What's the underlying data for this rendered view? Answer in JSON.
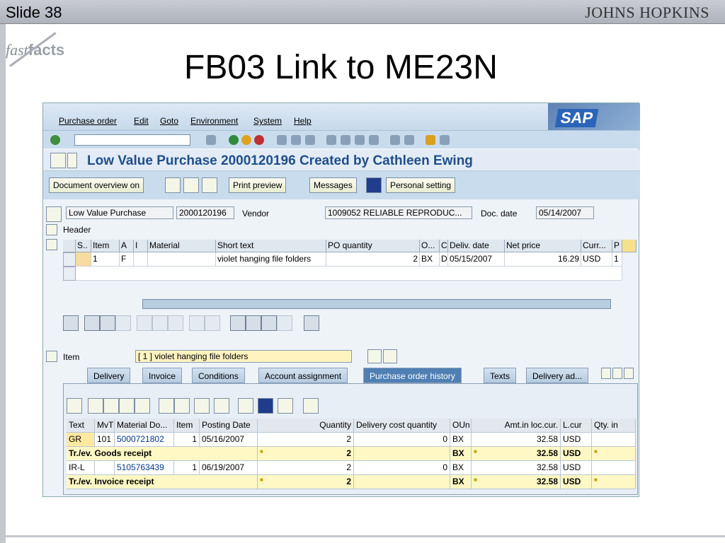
{
  "slide": {
    "number": "Slide 38",
    "brand": "JOHNS HOPKINS",
    "logo_fast": "fast",
    "logo_facts": "facts",
    "title": "FB03 Link to ME23N"
  },
  "sap": {
    "menu": [
      "Purchase order",
      "Edit",
      "Goto",
      "Environment",
      "System",
      "Help"
    ],
    "logo": "SAP",
    "heading": "Low Value Purchase 2000120196 Created by Cathleen Ewing",
    "app_buttons": {
      "doc_overview": "Document overview on",
      "print_preview": "Print preview",
      "messages": "Messages",
      "personal_setting": "Personal setting"
    },
    "header": {
      "doc_type": "Low Value Purchase",
      "po_number": "2000120196",
      "vendor_label": "Vendor",
      "vendor": "1009052 RELIABLE REPRODUC...",
      "doc_date_label": "Doc. date",
      "doc_date": "05/14/2007",
      "header_label": "Header"
    },
    "item_cols": [
      "S..",
      "Item",
      "A",
      "I",
      "Material",
      "Short text",
      "PO quantity",
      "O...",
      "C",
      "Deliv. date",
      "Net price",
      "Curr...",
      "P"
    ],
    "item_row": {
      "item": "1",
      "a": "F",
      "short_text": "violet hanging file folders",
      "qty": "2",
      "unit": "BX",
      "c": "D",
      "deliv_date": "05/15/2007",
      "net_price": "16.29",
      "curr": "USD",
      "p": "1"
    },
    "item_detail": {
      "label": "Item",
      "value": "[ 1 ] violet hanging file folders"
    },
    "tabs": [
      "Delivery",
      "Invoice",
      "Conditions",
      "Account assignment",
      "Purchase order history",
      "Texts",
      "Delivery ad..."
    ],
    "history_cols": [
      "Text",
      "MvT",
      "Material Do...",
      "Item",
      "Posting Date",
      "Quantity",
      "Delivery cost quantity",
      "OUn",
      "Amt.in loc.cur.",
      "L.cur",
      "Qty. in"
    ],
    "history_rows": [
      {
        "text": "GR",
        "mvt": "101",
        "doc": "5000721802",
        "item": "1",
        "date": "05/16/2007",
        "qty": "2",
        "dcq": "0",
        "oun": "BX",
        "amt": "32.58",
        "cur": "USD"
      },
      {
        "text": "Tr./ev. Goods receipt",
        "qty": "2",
        "oun": "BX",
        "amt": "32.58",
        "cur": "USD"
      },
      {
        "text": "IR-L",
        "mvt": "",
        "doc": "5105763439",
        "item": "1",
        "date": "06/19/2007",
        "qty": "2",
        "dcq": "0",
        "oun": "BX",
        "amt": "32.58",
        "cur": "USD"
      },
      {
        "text": "Tr./ev. Invoice receipt",
        "qty": "2",
        "oun": "BX",
        "amt": "32.58",
        "cur": "USD"
      }
    ],
    "sum_marker": "■"
  }
}
